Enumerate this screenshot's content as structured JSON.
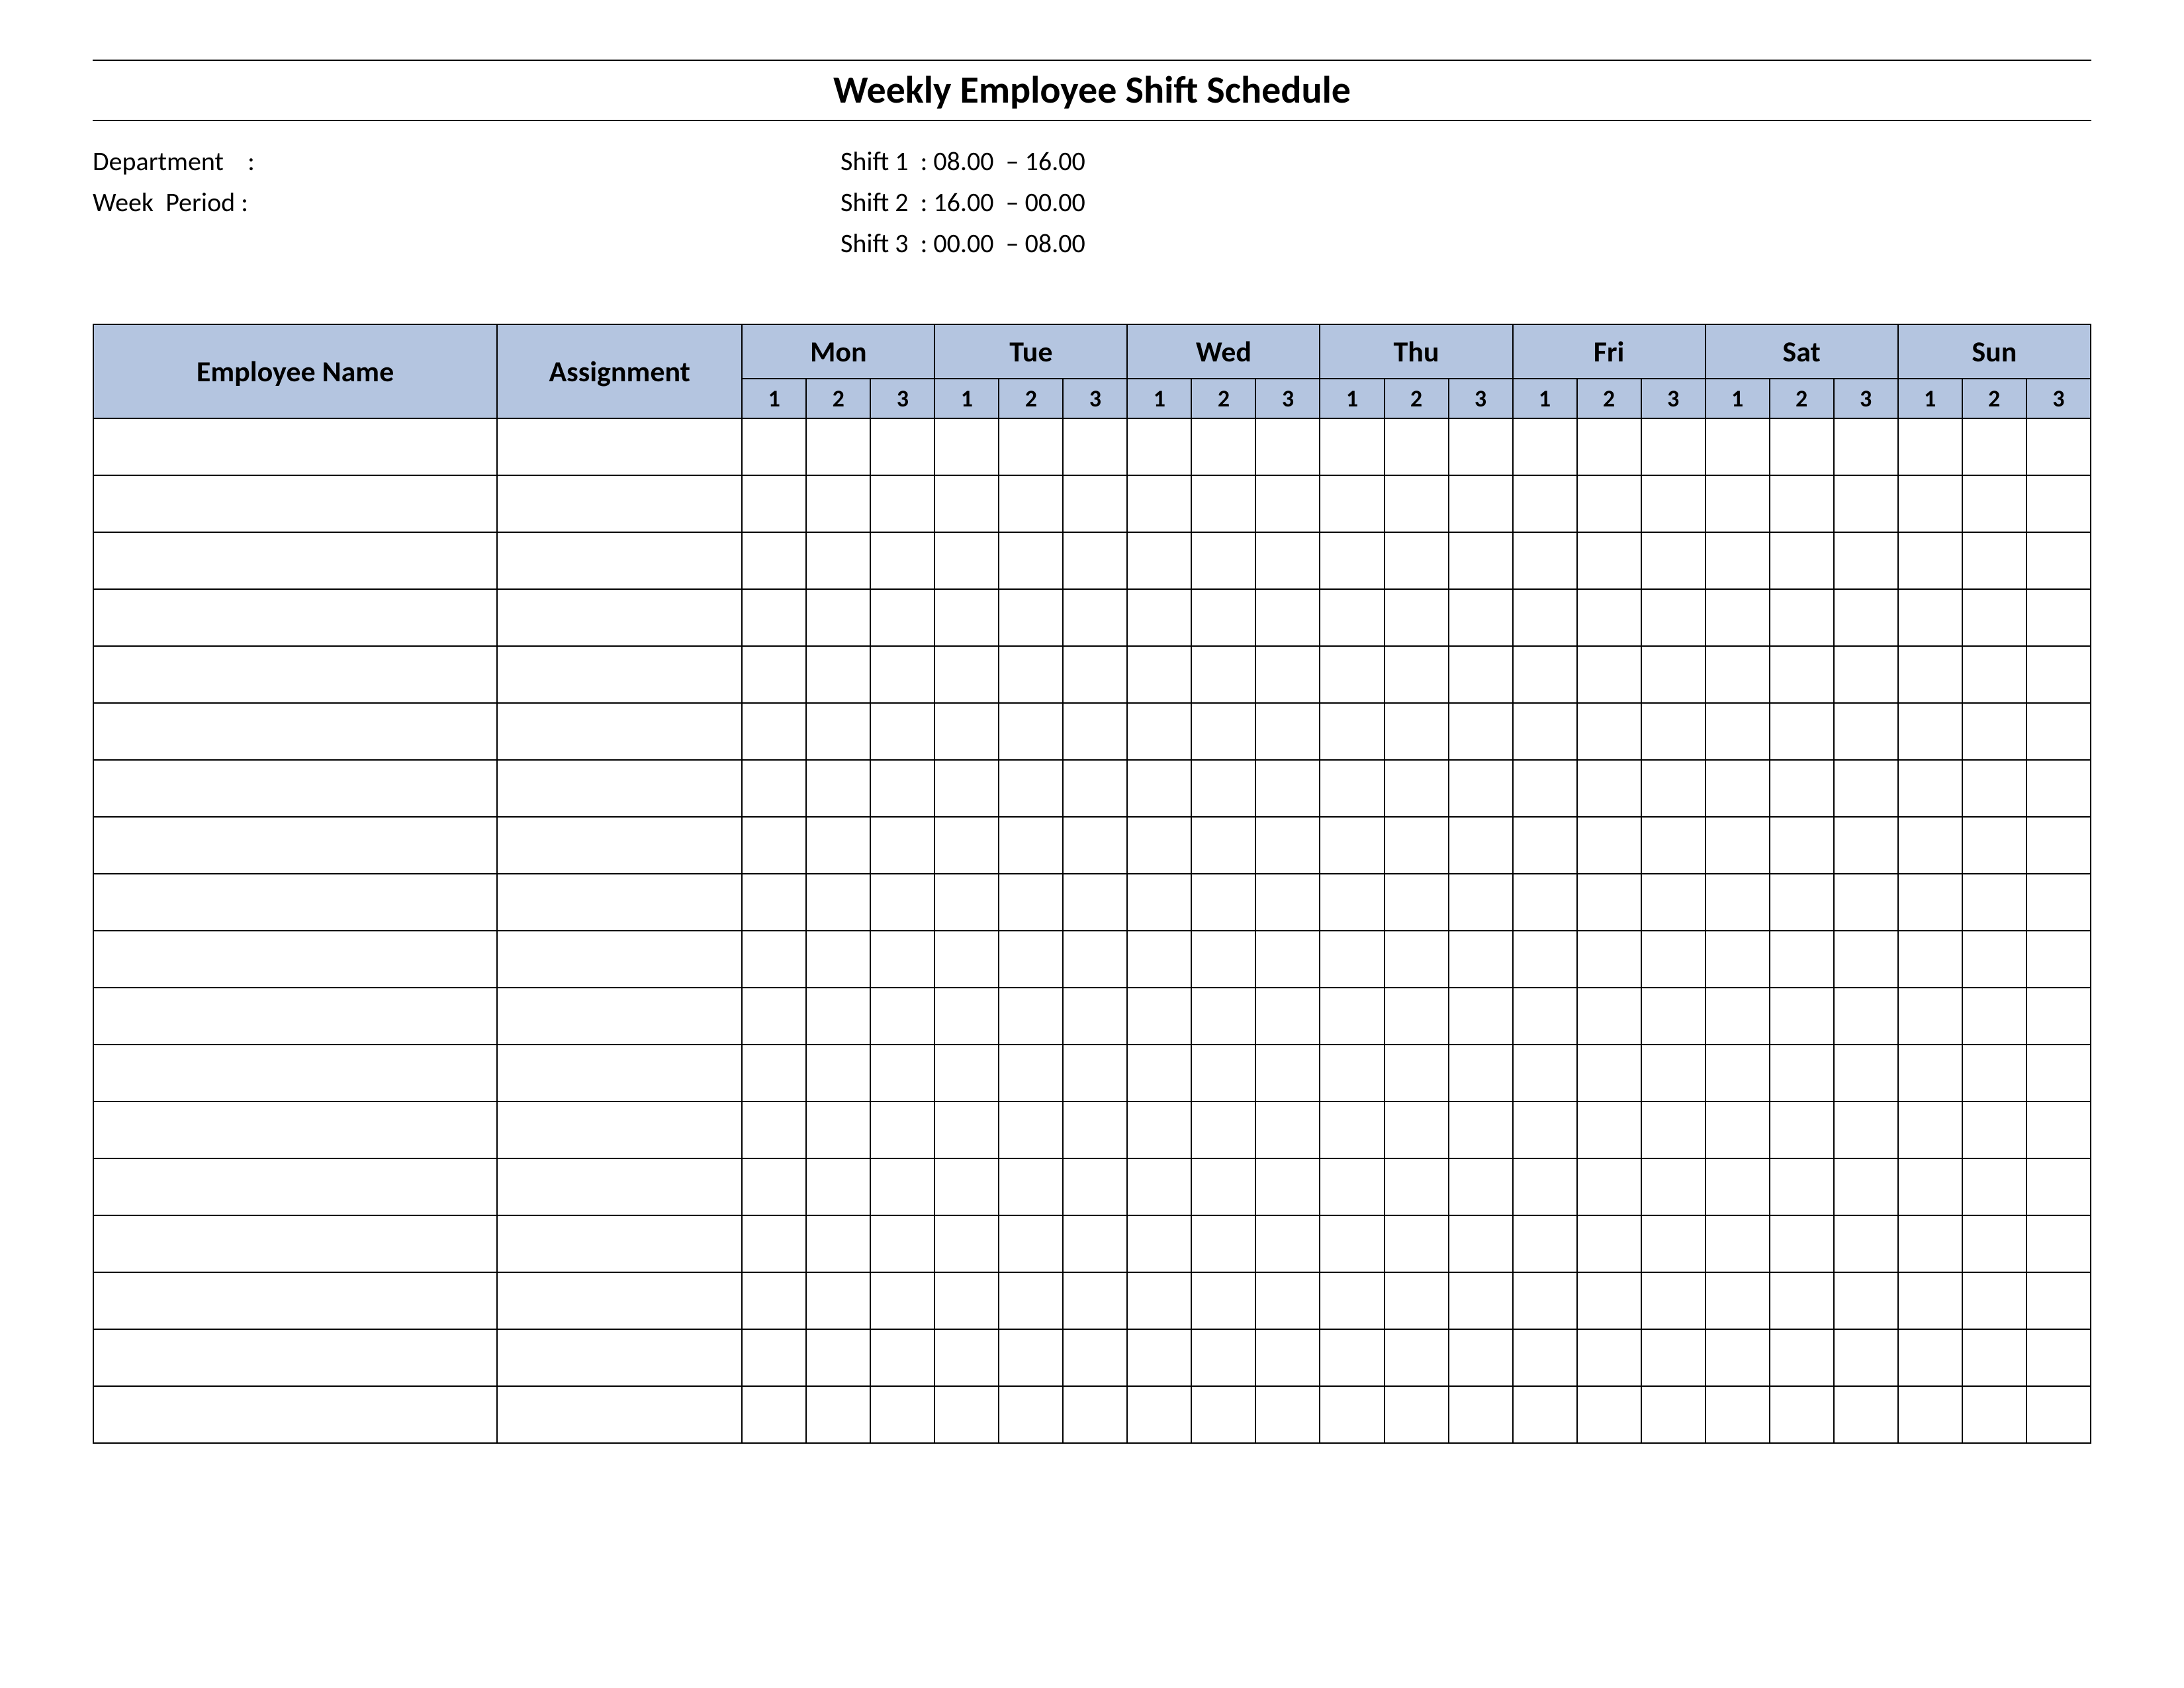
{
  "title": "Weekly Employee Shift Schedule",
  "meta": {
    "department_label": "Department    :",
    "week_period_label": "Week  Period :",
    "shift1": "Shift 1  : 08.00  – 16.00",
    "shift2": "Shift 2  : 16.00  – 00.00",
    "shift3": "Shift 3  : 00.00  – 08.00"
  },
  "headers": {
    "employee_name": "Employee Name",
    "assignment": "Assignment",
    "days": [
      "Mon",
      "Tue",
      "Wed",
      "Thu",
      "Fri",
      "Sat",
      "Sun"
    ],
    "shifts": [
      "1",
      "2",
      "3"
    ]
  },
  "row_count": 18
}
